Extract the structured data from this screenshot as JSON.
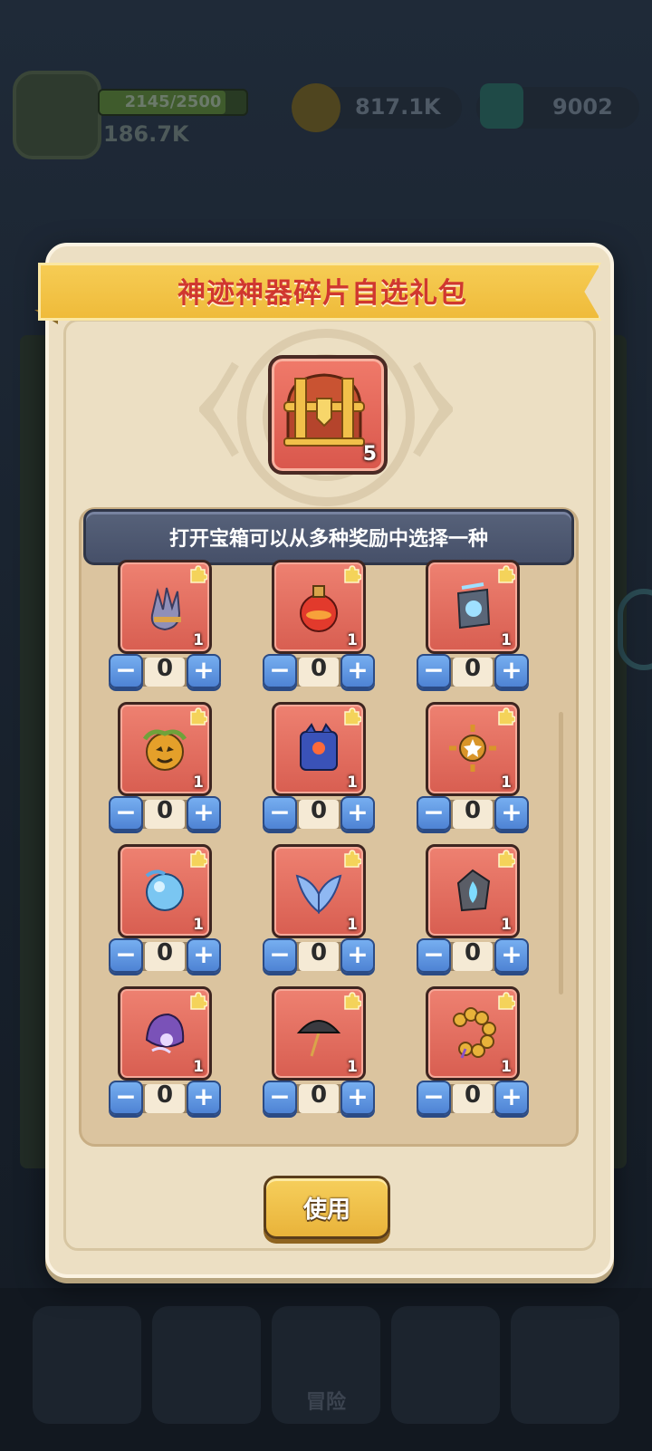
{
  "background": {
    "exp_text": "2145/2500",
    "exp_progress": 0.858,
    "power_text": "186.7K",
    "gold_text": "817.1K",
    "gems_text": "9002",
    "nav_adventure_label": "冒险"
  },
  "dialog": {
    "title": "神迹神器碎片自选礼包",
    "chest_count": "5",
    "panel_header": "打开宝箱可以从多种奖励中选择一种",
    "use_label": "使用"
  },
  "items": [
    {
      "count": "1",
      "value": "0",
      "minus": "−",
      "plus": "+",
      "icon": "clawed-gauntlet-icon"
    },
    {
      "count": "1",
      "value": "0",
      "minus": "−",
      "plus": "+",
      "icon": "red-potion-icon"
    },
    {
      "count": "1",
      "value": "0",
      "minus": "−",
      "plus": "+",
      "icon": "ice-gauntlet-icon"
    },
    {
      "count": "1",
      "value": "0",
      "minus": "−",
      "plus": "+",
      "icon": "pumpkin-orb-icon"
    },
    {
      "count": "1",
      "value": "0",
      "minus": "−",
      "plus": "+",
      "icon": "blue-demon-tome-icon"
    },
    {
      "count": "1",
      "value": "0",
      "minus": "−",
      "plus": "+",
      "icon": "golden-star-emblem-icon"
    },
    {
      "count": "1",
      "value": "0",
      "minus": "−",
      "plus": "+",
      "icon": "water-orb-icon"
    },
    {
      "count": "1",
      "value": "0",
      "minus": "−",
      "plus": "+",
      "icon": "spirit-wings-icon"
    },
    {
      "count": "1",
      "value": "0",
      "minus": "−",
      "plus": "+",
      "icon": "blue-flame-stone-icon"
    },
    {
      "count": "1",
      "value": "0",
      "minus": "−",
      "plus": "+",
      "icon": "purple-shell-icon"
    },
    {
      "count": "1",
      "value": "0",
      "minus": "−",
      "plus": "+",
      "icon": "dark-umbrella-icon"
    },
    {
      "count": "1",
      "value": "0",
      "minus": "−",
      "plus": "+",
      "icon": "golden-beads-icon"
    }
  ],
  "colors": {
    "ribbon": "#f2c24a",
    "title_text": "#d0372f",
    "tile": "#e06a5c",
    "stepper_button": "#5d93e0",
    "use_button": "#efbf45"
  }
}
